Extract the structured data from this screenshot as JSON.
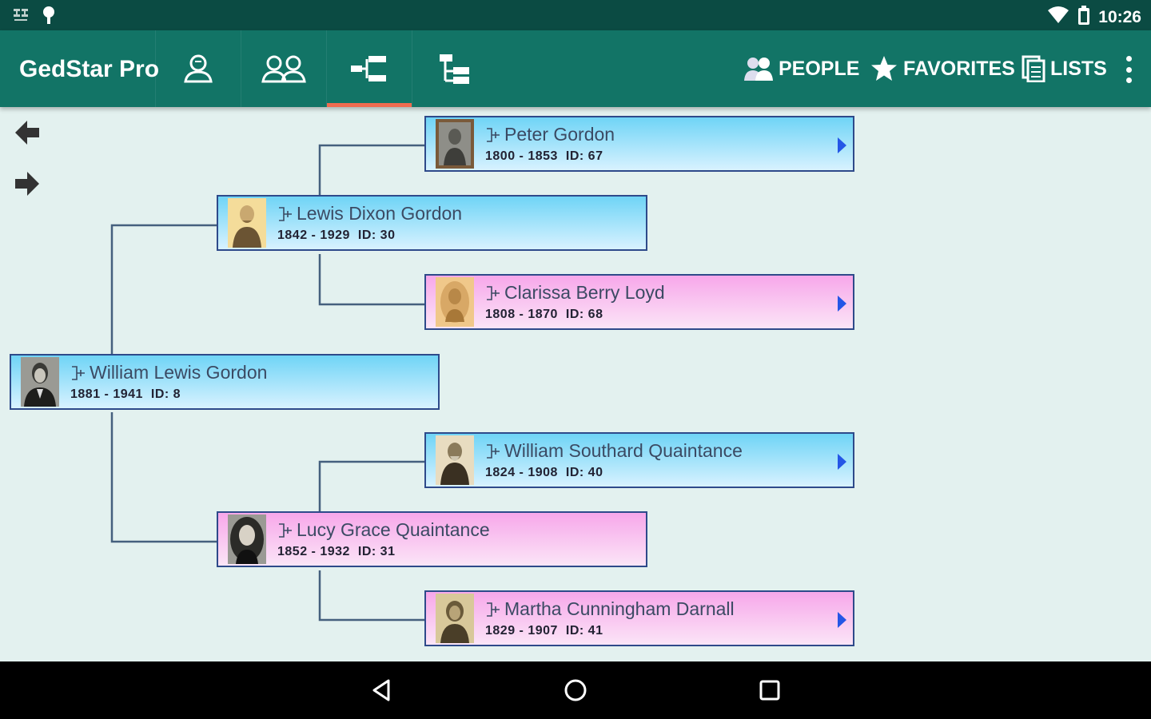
{
  "status_bar": {
    "time": "10:26",
    "icons": [
      "notification-icon",
      "location-icon",
      "wifi-icon",
      "battery-icon"
    ]
  },
  "app_bar": {
    "title": "GedStar Pro",
    "tabs": [
      {
        "icon": "person-icon",
        "active": false
      },
      {
        "icon": "family-icon",
        "active": false
      },
      {
        "icon": "pedigree-chart-icon",
        "active": true
      },
      {
        "icon": "descendant-tree-icon",
        "active": false
      }
    ],
    "actions": [
      {
        "label": "PEOPLE",
        "icon": "people-icon"
      },
      {
        "label": "FAVORITES",
        "icon": "star-icon"
      },
      {
        "label": "LISTS",
        "icon": "lists-icon"
      }
    ],
    "overflow_icon": "more-vert-icon",
    "accent_color": "#f06b4f",
    "bar_color": "#127466"
  },
  "pedigree": {
    "people": [
      {
        "name": "William Lewis Gordon",
        "years": "1881 - 1941",
        "id": "ID: 8",
        "gender": "male",
        "has_more": false
      },
      {
        "name": "Lewis Dixon Gordon",
        "years": "1842 - 1929",
        "id": "ID: 30",
        "gender": "male",
        "has_more": false
      },
      {
        "name": "Lucy Grace Quaintance",
        "years": "1852 - 1932",
        "id": "ID: 31",
        "gender": "female",
        "has_more": false
      },
      {
        "name": "Peter Gordon",
        "years": "1800 - 1853",
        "id": "ID: 67",
        "gender": "male",
        "has_more": true
      },
      {
        "name": "Clarissa Berry Loyd",
        "years": "1808 - 1870",
        "id": "ID: 68",
        "gender": "female",
        "has_more": true
      },
      {
        "name": "William Southard Quaintance",
        "years": "1824 - 1908",
        "id": "ID: 40",
        "gender": "male",
        "has_more": true
      },
      {
        "name": "Martha Cunningham Darnall",
        "years": "1829 - 1907",
        "id": "ID: 41",
        "gender": "female",
        "has_more": true
      }
    ],
    "male_color": "#6fd4f6",
    "female_color": "#f7a7ea"
  },
  "nav": {
    "back": "back-icon",
    "home": "home-icon",
    "recents": "recents-icon"
  }
}
